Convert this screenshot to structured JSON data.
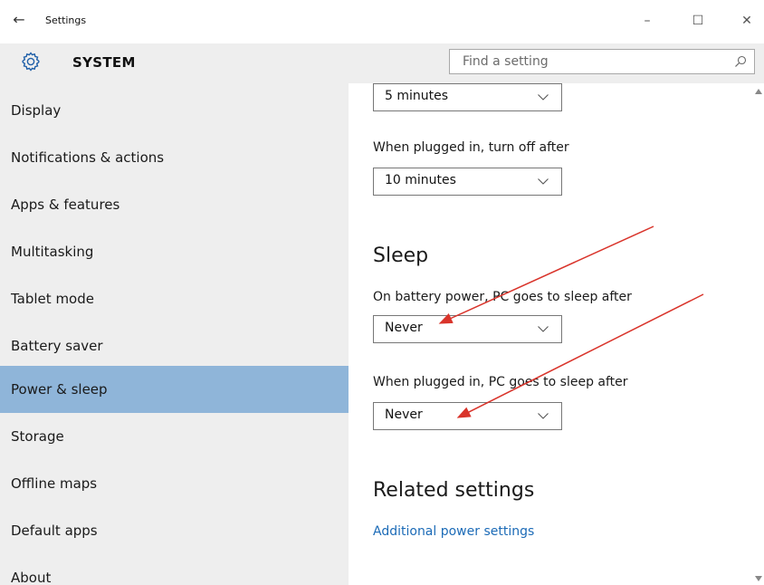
{
  "window": {
    "title": "Settings",
    "back_icon": "back-arrow-icon",
    "controls": {
      "minimize": "–",
      "maximize": "☐",
      "close": "✕"
    }
  },
  "header": {
    "title": "SYSTEM",
    "icon": "gear-icon",
    "search_placeholder": "Find a setting"
  },
  "sidebar": {
    "items": [
      {
        "label": "Display"
      },
      {
        "label": "Notifications & actions"
      },
      {
        "label": "Apps & features"
      },
      {
        "label": "Multitasking"
      },
      {
        "label": "Tablet mode"
      },
      {
        "label": "Battery saver"
      },
      {
        "label": "Power & sleep",
        "selected": true
      },
      {
        "label": "Storage"
      },
      {
        "label": "Offline maps"
      },
      {
        "label": "Default apps"
      },
      {
        "label": "About"
      }
    ]
  },
  "content": {
    "screen_battery_value": "5 minutes",
    "screen_plugged_label": "When plugged in, turn off after",
    "screen_plugged_value": "10 minutes",
    "sleep_heading": "Sleep",
    "sleep_battery_label": "On battery power, PC goes to sleep after",
    "sleep_battery_value": "Never",
    "sleep_plugged_label": "When plugged in, PC goes to sleep after",
    "sleep_plugged_value": "Never",
    "related_heading": "Related settings",
    "related_link": "Additional power settings"
  },
  "colors": {
    "sidebar_bg": "#eeeeee",
    "selected_bg": "#8fb5d9",
    "link": "#1c6bb7",
    "annotation_arrow": "#d9342b"
  }
}
